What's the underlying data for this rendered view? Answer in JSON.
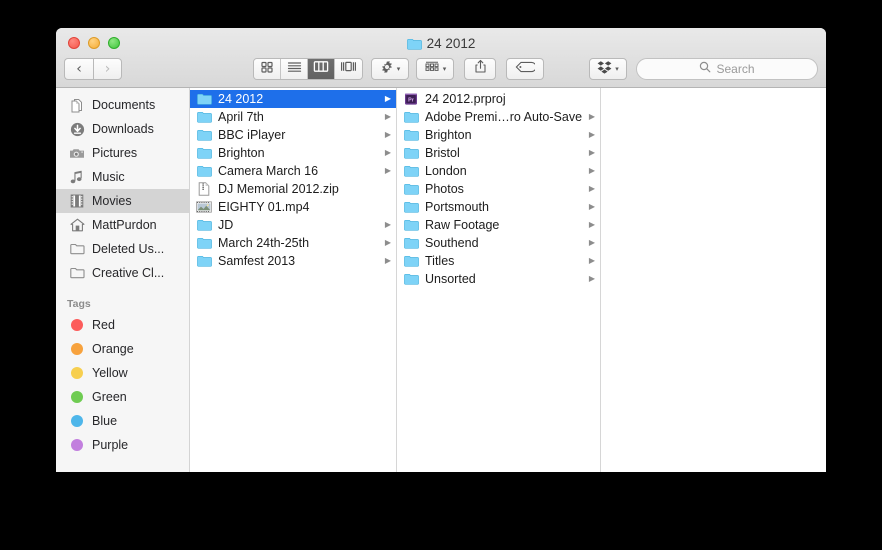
{
  "window": {
    "title": "24 2012",
    "title_icon": "folder-icon",
    "traffic_lights": [
      {
        "name": "close-button",
        "color": "#f5564a"
      },
      {
        "name": "minimize-button",
        "color": "#f5ac35"
      },
      {
        "name": "maximize-button",
        "color": "#3fc63a"
      }
    ]
  },
  "toolbar": {
    "back_label": "‹",
    "forward_label": "›",
    "view_modes": [
      {
        "name": "icon-view",
        "icon": "grid-icon",
        "active": false
      },
      {
        "name": "list-view",
        "icon": "list-icon",
        "active": false
      },
      {
        "name": "column-view",
        "icon": "columns-icon",
        "active": true
      },
      {
        "name": "gallery-view",
        "icon": "gallery-icon",
        "active": false
      }
    ],
    "action_button": "gear-icon",
    "arrange_button": "arrange-grid-icon",
    "share_button": "share-icon",
    "tag_button": "tag-icon",
    "dropbox_button": "dropbox-icon",
    "chevron": "▾"
  },
  "search": {
    "icon": "search-icon",
    "placeholder": "Search",
    "value": ""
  },
  "sidebar": {
    "favorites": [
      {
        "label": "Documents",
        "icon": "documents-icon",
        "selected": false
      },
      {
        "label": "Downloads",
        "icon": "download-icon",
        "selected": false
      },
      {
        "label": "Pictures",
        "icon": "camera-icon",
        "selected": false
      },
      {
        "label": "Music",
        "icon": "music-note-icon",
        "selected": false
      },
      {
        "label": "Movies",
        "icon": "film-icon",
        "selected": true
      },
      {
        "label": "MattPurdon",
        "icon": "home-icon",
        "selected": false
      },
      {
        "label": "Deleted Us...",
        "icon": "folder-icon",
        "selected": false
      },
      {
        "label": "Creative Cl...",
        "icon": "folder-icon",
        "selected": false
      }
    ],
    "tags_header": "Tags",
    "tags": [
      {
        "label": "Red",
        "color": "#fc5c5b"
      },
      {
        "label": "Orange",
        "color": "#f7a23d"
      },
      {
        "label": "Yellow",
        "color": "#f7cf4f"
      },
      {
        "label": "Green",
        "color": "#6fcc52"
      },
      {
        "label": "Blue",
        "color": "#4eb6ea"
      },
      {
        "label": "Purple",
        "color": "#c27fde"
      }
    ]
  },
  "columns": [
    {
      "name": "column-1",
      "items": [
        {
          "label": "24 2012",
          "icon": "folder-icon",
          "arrow": true,
          "selected": true
        },
        {
          "label": "April 7th",
          "icon": "folder-icon",
          "arrow": true,
          "selected": false
        },
        {
          "label": "BBC iPlayer",
          "icon": "folder-icon",
          "arrow": true,
          "selected": false
        },
        {
          "label": "Brighton",
          "icon": "folder-icon",
          "arrow": true,
          "selected": false
        },
        {
          "label": "Camera March 16",
          "icon": "folder-icon",
          "arrow": true,
          "selected": false
        },
        {
          "label": "DJ Memorial 2012.zip",
          "icon": "zip-icon",
          "arrow": false,
          "selected": false
        },
        {
          "label": "EIGHTY 01.mp4",
          "icon": "movie-icon",
          "arrow": false,
          "selected": false
        },
        {
          "label": "JD",
          "icon": "folder-icon",
          "arrow": true,
          "selected": false
        },
        {
          "label": "March 24th-25th",
          "icon": "folder-icon",
          "arrow": true,
          "selected": false
        },
        {
          "label": "Samfest 2013",
          "icon": "folder-icon",
          "arrow": true,
          "selected": false
        }
      ]
    },
    {
      "name": "column-2",
      "items": [
        {
          "label": "24 2012.prproj",
          "icon": "premiere-icon",
          "arrow": false,
          "selected": false
        },
        {
          "label": "Adobe Premi…ro Auto-Save",
          "icon": "folder-icon",
          "arrow": true,
          "selected": false
        },
        {
          "label": "Brighton",
          "icon": "folder-icon",
          "arrow": true,
          "selected": false
        },
        {
          "label": "Bristol",
          "icon": "folder-icon",
          "arrow": true,
          "selected": false
        },
        {
          "label": "London",
          "icon": "folder-icon",
          "arrow": true,
          "selected": false
        },
        {
          "label": "Photos",
          "icon": "folder-icon",
          "arrow": true,
          "selected": false
        },
        {
          "label": "Portsmouth",
          "icon": "folder-icon",
          "arrow": true,
          "selected": false
        },
        {
          "label": "Raw Footage",
          "icon": "folder-icon",
          "arrow": true,
          "selected": false
        },
        {
          "label": "Southend",
          "icon": "folder-icon",
          "arrow": true,
          "selected": false
        },
        {
          "label": "Titles",
          "icon": "folder-icon",
          "arrow": true,
          "selected": false
        },
        {
          "label": "Unsorted",
          "icon": "folder-icon",
          "arrow": true,
          "selected": false
        }
      ]
    },
    {
      "name": "column-3",
      "items": []
    }
  ],
  "colors": {
    "selection_blue": "#1e6fea",
    "folder_blue": "#6fd0f5",
    "sidebar_bg": "#f6f6f6",
    "titlebar_top": "#e9e9e9",
    "titlebar_bottom": "#d8d8d8"
  }
}
